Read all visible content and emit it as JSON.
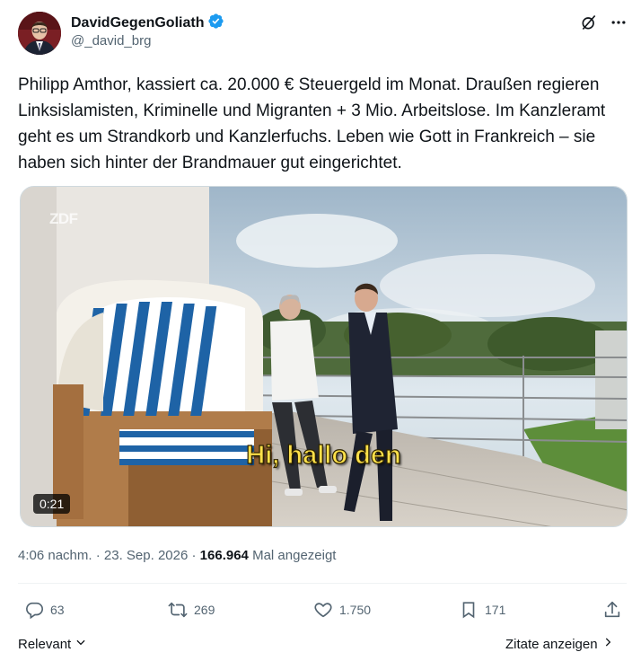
{
  "author": {
    "display_name": "DavidGegenGoliath",
    "handle": "@_david_brg",
    "verified": true,
    "verified_color": "#1d9bf0"
  },
  "header_icons": [
    "grok-icon",
    "more-icon"
  ],
  "tweet": {
    "text": "Philipp Amthor, kassiert ca. 20.000 € Steuergeld im Monat. Draußen regieren Linksislamisten, Kriminelle und Migranten + 3 Mio. Arbeitslose. Im Kanzleramt geht es um Strandkorb und Kanzlerfuchs. Leben wie Gott in Frankreich – sie haben sich hinter der Brandmauer gut eingerichtet."
  },
  "video": {
    "timecode": "0:21",
    "subtitle": "Hi, hallo den",
    "watermark": "ZDF"
  },
  "meta": {
    "time": "4:06 nachm.",
    "sep1": " · ",
    "date": "23. Sep. 2026",
    "sep2": " · ",
    "views_count": "166.964",
    "views_label": " Mal angezeigt"
  },
  "actions": {
    "replies": "63",
    "reposts": "269",
    "likes": "1.750",
    "bookmarks": "171"
  },
  "footer": {
    "relevant": "Relevant",
    "quotes": "Zitate anzeigen"
  }
}
